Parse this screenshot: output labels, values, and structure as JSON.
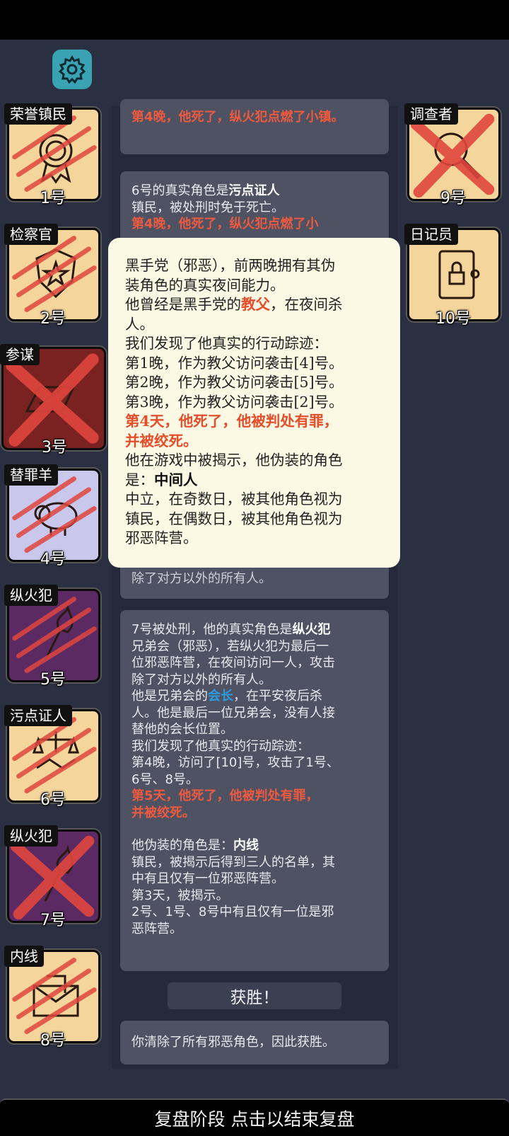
{
  "settings_icon": "gear-icon",
  "feed": {
    "card_top": {
      "line_red": "第4晚，他死了，纵火犯点燃了小镇。"
    },
    "card_6": {
      "line1_prefix": "6号的真实角色是",
      "line1_role": "污点证人",
      "line2": "镇民，被处刑时免于死亡。",
      "line3_red": "第4晚，他死了，纵火犯点燃了小"
    },
    "card_mid_tail": "除了对方以外的所有人。",
    "card_7": {
      "l1_prefix": "7号被处刑，他的真实角色是",
      "l1_role": "纵火犯",
      "l2": "兄弟会（邪恶），若纵火犯为最后一",
      "l3": "位邪恶阵营，在夜间访问一人，攻击",
      "l4": "除了对方以外的所有人。",
      "l5_prefix": "他是兄弟会的",
      "l5_title": "会长",
      "l5_suffix": "，在平安夜后杀",
      "l6": "人。他是最后一位兄弟会，没有人接",
      "l7": "替他的会长位置。",
      "l8": "我们发现了他真实的行动踪迹：",
      "l9": "第4晚，访问了[10]号，攻击了1号、",
      "l10": "6号、8号。",
      "l11_red": "第5天，他死了，他被判处有罪，",
      "l12_red": "并被绞死。",
      "l13_prefix": "他伪装的角色是：",
      "l13_role": "内线",
      "l14": "镇民，被揭示后得到三人的名单，其",
      "l15": "中有且仅有一位邪恶阵营。",
      "l16": "第3天，被揭示。",
      "l17": "2号、1号、8号中有且仅有一位是邪",
      "l18": "恶阵营。"
    },
    "victory_label": "获胜！",
    "card_final": "你清除了所有邪恶角色，因此获胜。"
  },
  "popup": {
    "l1": "黑手党（邪恶），前两晚拥有其伪",
    "l2": "装角色的真实夜间能力。",
    "l3_prefix": "他曾经是黑手党的",
    "l3_title": "教父",
    "l3_suffix": "，在夜间杀",
    "l4": "人。",
    "l5": "我们发现了他真实的行动踪迹：",
    "l6": "第1晚，作为教父访问袭击[4]号。",
    "l7": "第2晚，作为教父访问袭击[5]号。",
    "l8": "第3晚，作为教父访问袭击[2]号。",
    "l9_red": "第4天，他死了，他被判处有罪，",
    "l10_red": "并被绞死。",
    "l11": "他在游戏中被揭示，他伪装的角色",
    "l12_prefix": "是：",
    "l12_role": "中间人",
    "l13": "中立，在奇数日，被其他角色视为",
    "l14": "镇民，在偶数日，被其他角色视为",
    "l15": "邪恶阵营。"
  },
  "players_left": [
    {
      "role": "荣誉镇民",
      "num": "1号",
      "icon": "medal-icon"
    },
    {
      "role": "检察官",
      "num": "2号",
      "icon": "badge-emblem-icon"
    },
    {
      "role": "参谋",
      "num": "3号",
      "icon": "map-scroll-icon"
    },
    {
      "role": "替罪羊",
      "num": "4号",
      "icon": "sheep-icon"
    },
    {
      "role": "纵火犯",
      "num": "5号",
      "icon": "torch-icon"
    },
    {
      "role": "污点证人",
      "num": "6号",
      "icon": "scales-handshake-icon"
    },
    {
      "role": "纵火犯",
      "num": "7号",
      "icon": "torch-icon"
    },
    {
      "role": "内线",
      "num": "8号",
      "icon": "envelope-icon"
    }
  ],
  "players_right": [
    {
      "role": "调查者",
      "num": "9号",
      "icon": "magnifier-icon"
    },
    {
      "role": "日记员",
      "num": "10号",
      "icon": "locked-diary-icon"
    }
  ],
  "bottom_bar": "复盘阶段 点击以结束复盘",
  "colors": {
    "background": "#2b2f42",
    "card": "#4e5263",
    "popup": "#fbf8e4",
    "highlight_red": "#ee5a3f",
    "highlight_blue": "#2e9be0",
    "town_card": "#f4d59c",
    "evil_card_purple": "#5b2a63",
    "mafia_card": "#7a2222",
    "lavender_card": "#c9c8ec"
  }
}
